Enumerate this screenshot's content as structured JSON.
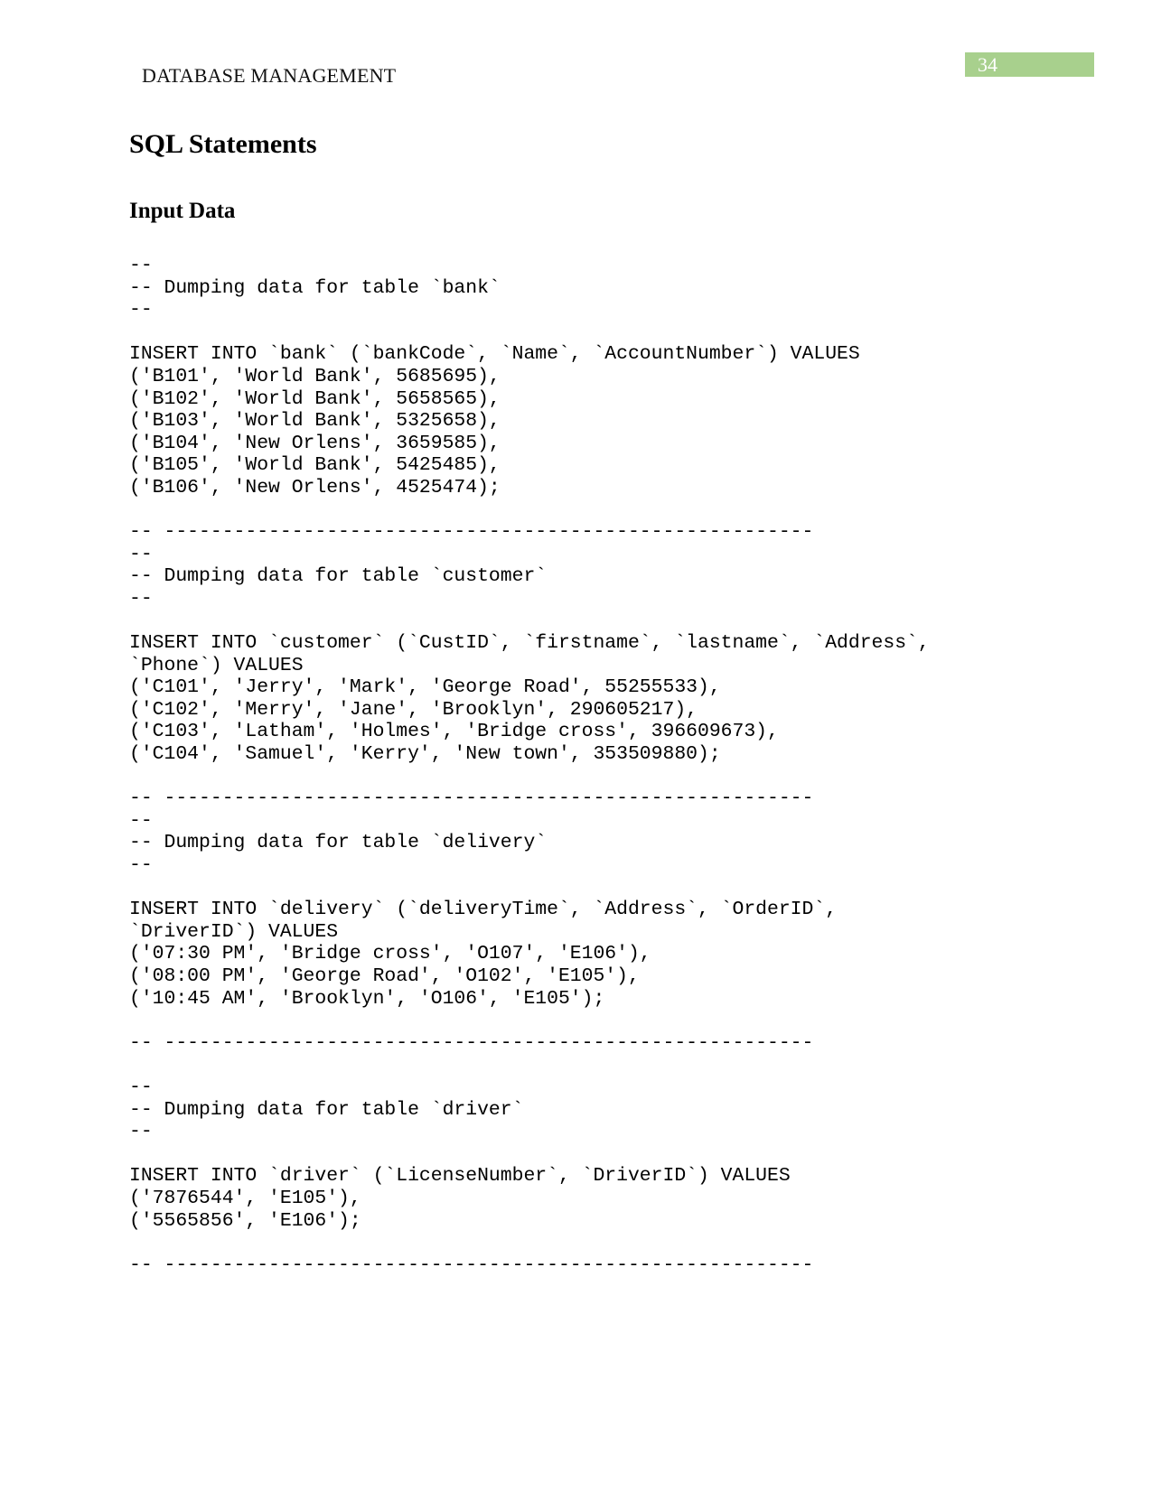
{
  "header": {
    "running_title": "DATABASE MANAGEMENT",
    "page_number": "34",
    "page_number_color": "#a8d08d"
  },
  "heading": "SQL Statements",
  "subheading": "Input Data",
  "code_lines": [
    "--",
    "-- Dumping data for table `bank`",
    "--",
    "",
    "INSERT INTO `bank` (`bankCode`, `Name`, `AccountNumber`) VALUES",
    "('B101', 'World Bank', 5685695),",
    "('B102', 'World Bank', 5658565),",
    "('B103', 'World Bank', 5325658),",
    "('B104', 'New Orlens', 3659585),",
    "('B105', 'World Bank', 5425485),",
    "('B106', 'New Orlens', 4525474);",
    "",
    "-- --------------------------------------------------------",
    "--",
    "-- Dumping data for table `customer`",
    "--",
    "",
    "INSERT INTO `customer` (`CustID`, `firstname`, `lastname`, `Address`,",
    "`Phone`) VALUES",
    "('C101', 'Jerry', 'Mark', 'George Road', 55255533),",
    "('C102', 'Merry', 'Jane', 'Brooklyn', 290605217),",
    "('C103', 'Latham', 'Holmes', 'Bridge cross', 396609673),",
    "('C104', 'Samuel', 'Kerry', 'New town', 353509880);",
    "",
    "-- --------------------------------------------------------",
    "--",
    "-- Dumping data for table `delivery`",
    "--",
    "",
    "INSERT INTO `delivery` (`deliveryTime`, `Address`, `OrderID`,",
    "`DriverID`) VALUES",
    "('07:30 PM', 'Bridge cross', 'O107', 'E106'),",
    "('08:00 PM', 'George Road', 'O102', 'E105'),",
    "('10:45 AM', 'Brooklyn', 'O106', 'E105');",
    "",
    "-- --------------------------------------------------------",
    "",
    "--",
    "-- Dumping data for table `driver`",
    "--",
    "",
    "INSERT INTO `driver` (`LicenseNumber`, `DriverID`) VALUES",
    "('7876544', 'E105'),",
    "('5565856', 'E106');",
    "",
    "-- --------------------------------------------------------"
  ]
}
